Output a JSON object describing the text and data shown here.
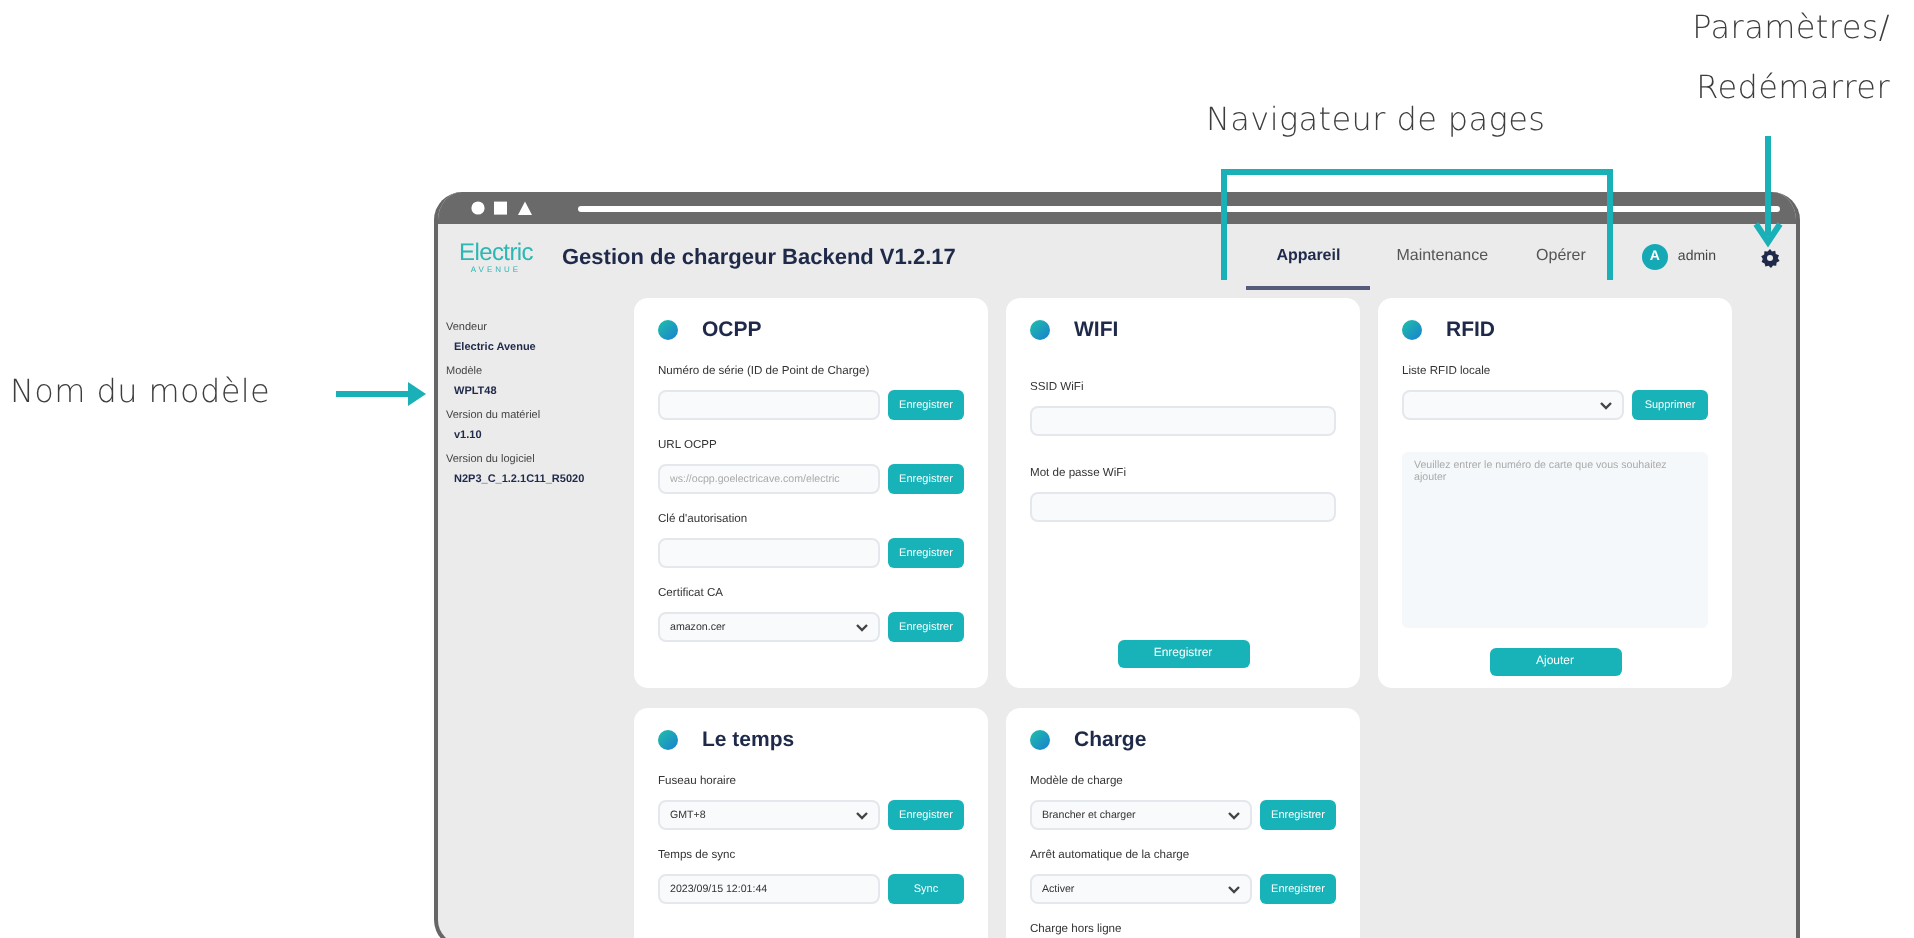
{
  "annotations": {
    "settings_label": [
      "Paramètres/",
      "Redémarrer"
    ],
    "navigator_label": "Navigateur de pages",
    "model_label": "Nom du modèle"
  },
  "header": {
    "logo": "Electric",
    "logo_tagline": "AVENUE",
    "title": "Gestion de chargeur Backend V1.2.17",
    "tabs": [
      {
        "label": "Appareil",
        "selected": true
      },
      {
        "label": "Maintenance",
        "selected": false
      },
      {
        "label": "Opérer",
        "selected": false
      }
    ],
    "user": {
      "initial": "A",
      "name": "admin"
    }
  },
  "sidebar": {
    "items": [
      {
        "label": "Vendeur",
        "value": "Electric Avenue"
      },
      {
        "label": "Modèle",
        "value": "WPLT48"
      },
      {
        "label": "Version du matériel",
        "value": "v1.10"
      },
      {
        "label": "Version du logiciel",
        "value": "N2P3_C_1.2.1C11_R5020"
      }
    ]
  },
  "cards": [
    {
      "title": "OCPP",
      "fields": [
        {
          "kind": "input",
          "label": "Numéro de série (ID de Point de Charge)",
          "button": "Enregistrer"
        },
        {
          "kind": "input",
          "label": "URL OCPP",
          "placeholder": "ws://ocpp.goelectricave.com/electric",
          "button": "Enregistrer"
        },
        {
          "kind": "input",
          "label": "Clé d'autorisation",
          "button": "Enregistrer"
        },
        {
          "kind": "select",
          "label": "Certificat CA",
          "value": "amazon.cer",
          "button": "Enregistrer"
        }
      ]
    },
    {
      "title": "WIFI",
      "fields": [
        {
          "kind": "input",
          "label": "SSID WiFi"
        },
        {
          "kind": "input",
          "label": "Mot de passe WiFi"
        }
      ],
      "footer_button": "Enregistrer"
    },
    {
      "title": "RFID",
      "fields": [
        {
          "kind": "select",
          "label": "Liste RFID locale",
          "button": "Supprimer"
        },
        {
          "kind": "textarea",
          "placeholder": "Veuillez entrer le numéro de carte que vous souhaitez ajouter"
        }
      ],
      "footer_button": "Ajouter"
    },
    {
      "title": "Le temps",
      "fields": [
        {
          "kind": "select",
          "label": "Fuseau horaire",
          "value": "GMT+8",
          "button": "Enregistrer"
        },
        {
          "kind": "input",
          "label": "Temps de sync",
          "value": "2023/09/15 12:01:44",
          "button": "Sync"
        }
      ]
    },
    {
      "title": "Charge",
      "fields": [
        {
          "kind": "select",
          "label": "Modèle de charge",
          "value": "Brancher et charger",
          "button": "Enregistrer"
        },
        {
          "kind": "select",
          "label": "Arrêt automatique de la charge",
          "value": "Activer",
          "button": "Enregistrer"
        },
        {
          "kind": "label",
          "label": "Charge hors ligne"
        }
      ]
    }
  ]
}
